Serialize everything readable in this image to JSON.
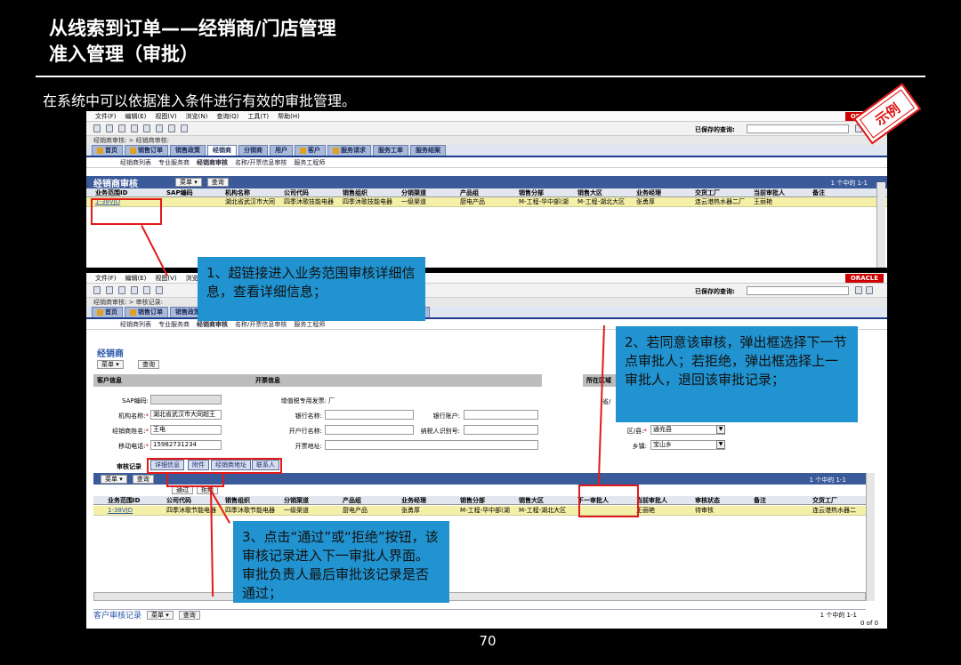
{
  "slide": {
    "title_line1": "从线索到订单——经销商/门店管理",
    "title_line2": "准入管理（审批）",
    "subtitle": "在系统中可以依据准入条件进行有效的审批管理。",
    "page_number": "70",
    "stamp": "示例"
  },
  "app": {
    "menu": [
      "文件(F)",
      "编辑(E)",
      "视图(V)",
      "浏览(N)",
      "查询(Q)",
      "工具(T)",
      "帮助(H)"
    ],
    "brand": "ORACLE",
    "saved_query_label": "已保存的查询:",
    "tabs": [
      "首页",
      "销售订单",
      "销售政策",
      "经销商",
      "分销商",
      "用户",
      "客户",
      "服务请求",
      "服务工单",
      "服务结案"
    ],
    "subnav": [
      "经销商列表",
      "专业服务商",
      "经销商审核",
      "名称/开票信息审核",
      "服务工程师"
    ]
  },
  "window1": {
    "breadcrumb": "经销商审核: > 经销商审核:",
    "panel_title": "经销商审核",
    "menu_btn": "菜单 ▾",
    "query_btn": "查询",
    "count": "1 个中的 1-1",
    "columns": [
      "业务范围ID",
      "SAP编码",
      "机构名称",
      "公司代码",
      "销售组织",
      "分销渠道",
      "产品组",
      "销售分部",
      "销售大区",
      "业务经理",
      "交货工厂",
      "当前审批人",
      "备注"
    ],
    "row": [
      "1-38VJD",
      "",
      "湖北省武汉市大同",
      "四季沐歌技能电器",
      "四季沐歌技能电器",
      "一级渠道",
      "厨电产品",
      "M-工程-华中部(湖",
      "M-工程-湖北大区",
      "张勇厚",
      "连云港热水器二厂",
      "王丽艳",
      ""
    ]
  },
  "window2": {
    "breadcrumb": "经销商审核: > 审核记录:",
    "form_title": "经销商",
    "menu_btn": "菜单 ▾",
    "query_btn": "查询",
    "sec_customer": "客户信息",
    "sec_invoice": "开票信息",
    "sec_region": "所在区域",
    "sap_label": "SAP编码:",
    "org_label": "机构名称:",
    "org_value": "湖北省武汉市大同超王",
    "owner_label": "经销商姓名:",
    "owner_value": "王电",
    "mobile_label": "移动电话:",
    "mobile_value": "15982731234",
    "vat_label": "增值税专用发票:",
    "vat_value": "厂",
    "bank_label": "银行名称:",
    "account_label": "银行账户:",
    "opening_label": "开户行名称:",
    "taxid_label": "纳税人识别号:",
    "address_label": "开票地址:",
    "county_label": "区/县:",
    "county_value": "通充县",
    "town_label": "乡镇:",
    "town_value": "宝山乡",
    "region_short": "省/",
    "record_tabs": [
      "审核记录",
      "详细信息",
      "附件",
      "经销商地址",
      "联系人"
    ],
    "pass_btn": "通过",
    "reject_btn": "拒绝",
    "count": "1 个中的 1-1",
    "columns": [
      "业务范围ID",
      "公司代码",
      "销售组织",
      "分销渠道",
      "产品组",
      "业务经理",
      "销售分部",
      "销售大区",
      "下一审批人",
      "当前审批人",
      "审核状态",
      "备注",
      "交货工厂"
    ],
    "row": [
      "1-38VJD",
      "四季沐歌节能电器",
      "四季沐歌节能电器",
      "一级渠道",
      "厨电产品",
      "张勇厚",
      "M-工程-华中部(湖",
      "M-工程-湖北大区",
      "",
      "王丽艳",
      "待审核",
      "",
      "连云港热水器二"
    ],
    "bottom_panel_title": "客户审核记录",
    "bottom_count": "1 个中的 1-1",
    "bottom_count2": "0 of 0"
  },
  "callouts": {
    "one": "1、超链接进入业务范围审核详细信息，查看详细信息；",
    "two": "2、若同意该审核，弹出框选择下一节点审批人；若拒绝，弹出框选择上一审批人，退回该审批记录；",
    "three": "3、点击“通过”或“拒绝”按钮，该审核记录进入下一审批人界面。审批负责人最后审批该记录是否通过；"
  },
  "colors": {
    "accent_blue": "#2193d0",
    "highlight_red": "#e21a1a",
    "row_yellow": "#f5f0a8",
    "nav_blue": "#3b5a9a"
  }
}
